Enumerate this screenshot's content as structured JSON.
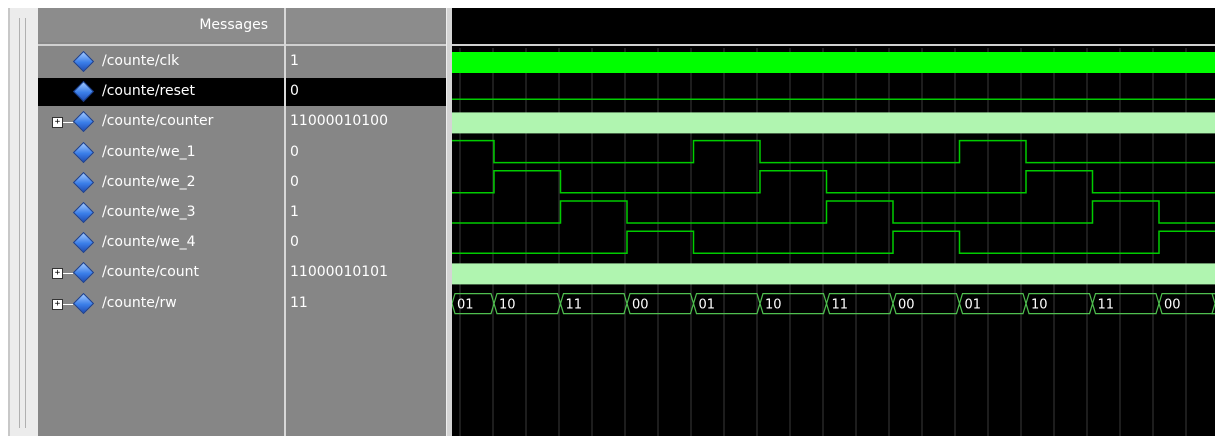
{
  "header": {
    "messages_label": "Messages"
  },
  "signals": [
    {
      "name": "/counte/clk",
      "value": "1",
      "expandable": false,
      "selected": false
    },
    {
      "name": "/counte/reset",
      "value": "0",
      "expandable": false,
      "selected": true
    },
    {
      "name": "/counte/counter",
      "value": "11000010100",
      "expandable": true,
      "selected": false
    },
    {
      "name": "/counte/we_1",
      "value": "0",
      "expandable": false,
      "selected": false
    },
    {
      "name": "/counte/we_2",
      "value": "0",
      "expandable": false,
      "selected": false
    },
    {
      "name": "/counte/we_3",
      "value": "1",
      "expandable": false,
      "selected": false
    },
    {
      "name": "/counte/we_4",
      "value": "0",
      "expandable": false,
      "selected": false
    },
    {
      "name": "/counte/count",
      "value": "11000010101",
      "expandable": true,
      "selected": false
    },
    {
      "name": "/counte/rw",
      "value": "11",
      "expandable": true,
      "selected": false
    }
  ],
  "expand_glyph": "+",
  "rw_bus_labels": [
    "01",
    "10",
    "11",
    "00",
    "01",
    "10",
    "11",
    "00",
    "01",
    "10",
    "11",
    "00"
  ],
  "colors": {
    "bright_green": "#00ff00",
    "pale_green": "#b0f5b0",
    "wire_green": "#00cc00",
    "bus_outline": "#4fbf4f",
    "grid": "#3a3a3a"
  }
}
